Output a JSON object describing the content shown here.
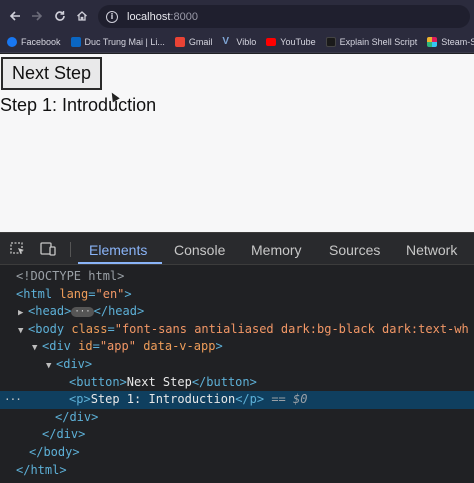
{
  "browser": {
    "address_host": "localhost",
    "address_port": ":8000",
    "bookmarks": [
      {
        "label": "Facebook",
        "icon": "facebook-icon",
        "color": "#1877f2"
      },
      {
        "label": "Duc Trung Mai | Li...",
        "icon": "linkedin-icon",
        "color": "#0a66c2"
      },
      {
        "label": "Gmail",
        "icon": "gmail-icon",
        "color": "#ea4335"
      },
      {
        "label": "Viblo",
        "icon": "viblo-icon",
        "color": "#5387c6"
      },
      {
        "label": "YouTube",
        "icon": "youtube-icon",
        "color": "#ff0000"
      },
      {
        "label": "Explain Shell Script",
        "icon": "shell-icon",
        "color": "#222222"
      },
      {
        "label": "Steam-Slack",
        "icon": "slack-icon",
        "color": "#e01e5a"
      }
    ]
  },
  "page": {
    "button_label": "Next Step",
    "paragraph": "Step 1: Introduction"
  },
  "devtools": {
    "tabs": [
      "Elements",
      "Console",
      "Memory",
      "Sources",
      "Network"
    ],
    "active_tab": "Elements",
    "dom": {
      "doctype": "<!DOCTYPE html>",
      "html_open": "<html",
      "html_lang_name": "lang",
      "html_lang_val": "\"en\"",
      "head_open": "<head>",
      "head_close": "</head>",
      "ellipsis": "···",
      "body_open": "<body",
      "body_class_name": "class",
      "body_class_val": "\"font-sans antialiased dark:bg-black dark:text-wh",
      "div_open": "<div",
      "div_id_name": "id",
      "div_id_val": "\"app\"",
      "div_data_attr": "data-v-app",
      "div_inner_open": "<div>",
      "button_open": "<button>",
      "button_text": "Next Step",
      "button_close": "</button>",
      "p_open": "<p>",
      "p_text": "Step 1: Introduction",
      "p_close": "</p>",
      "selected_marker": "== $0",
      "div_close": "</div>",
      "body_close": "</body>",
      "html_close": "</html>",
      "row_dots": "···"
    }
  }
}
